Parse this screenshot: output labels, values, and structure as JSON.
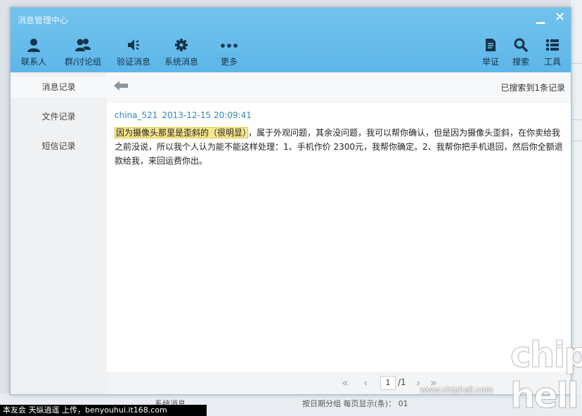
{
  "window": {
    "title": "消息管理中心"
  },
  "toolbar": {
    "contacts": "联系人",
    "groups": "群/讨论组",
    "verify": "验证消息",
    "system": "系统消息",
    "more": "更多",
    "evidence": "举证",
    "search": "搜索",
    "tools": "工具"
  },
  "nav": {
    "items": [
      "消息记录",
      "文件记录",
      "短信记录"
    ]
  },
  "content": {
    "result_count": "已搜索到1条记录",
    "message": {
      "sender": "china_521",
      "time": "2013-12-15 20:09:41",
      "highlight": "因为摄像头那里是歪斜的（很明显）",
      "rest": "，属于外观问题，其余没问题，我可以帮你确认，但是因为摄像头歪斜，在你卖给我之前没说，所以我个人认为能不能这样处理：1、手机作价 2300元，我帮你确定。2、我帮你把手机退回，然后你全额退款给我，来回运费你出。"
    }
  },
  "pager": {
    "current": "1",
    "total": "/1"
  },
  "background": {
    "bottom_left": "系统消息",
    "bottom_right": "按日期分组  每页显示(条)：  01"
  },
  "caption": "本友会 天纵逍遥 上传，benyouhui.it168.com",
  "watermark": {
    "logo": "chip hell",
    "url": "www.chiphell.com"
  },
  "colors": {
    "titlebar": "#6cbfed",
    "link": "#2f88b9",
    "highlight": "#f6e78f"
  }
}
